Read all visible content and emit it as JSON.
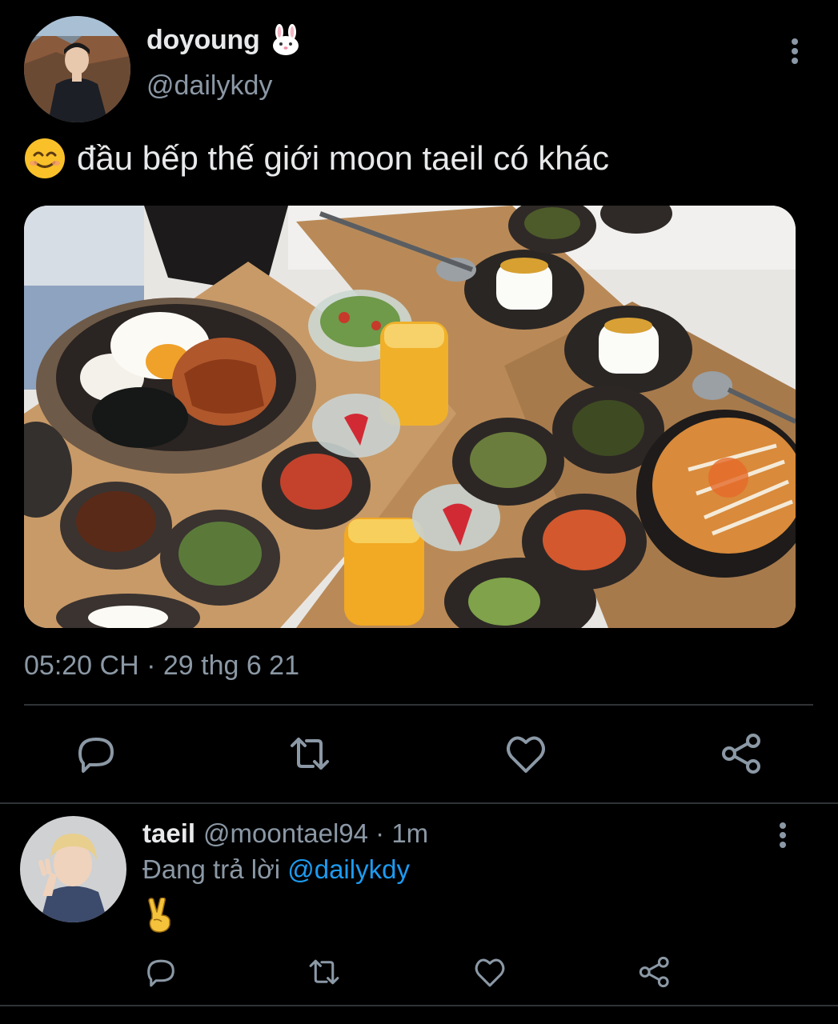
{
  "tweet": {
    "author_name": "doyoung",
    "author_handle": "@dailykdy",
    "text": "đầu bếp thế giới moon taeil có khác",
    "timestamp": "05:20 CH · 29 thg 6 21",
    "name_emoji_icon": "rabbit-face-icon",
    "text_emoji_icon": "smiling-face-icon",
    "media_description_icon": "food-photo"
  },
  "actions": [
    "reply-icon",
    "retweet-icon",
    "like-icon",
    "share-icon"
  ],
  "reply": {
    "author_name": "taeil",
    "author_meta": "@moontael94 · 1m",
    "replying_prefix": "Đang trả lời",
    "replying_mention": "@dailykdy",
    "body_icon": "victory-hand-icon"
  },
  "colors": {
    "background": "#000000",
    "text": "#e7e9ea",
    "secondary": "#8b98a5",
    "mention": "#1d9bf0",
    "divider": "#2f3336"
  }
}
